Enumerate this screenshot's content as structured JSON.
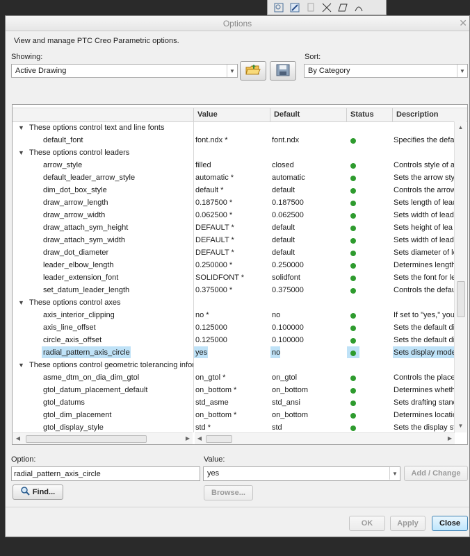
{
  "window": {
    "title": "Options",
    "close_glyph": "✕"
  },
  "description": "View and manage PTC Creo Parametric options.",
  "showing": {
    "label": "Showing:",
    "value": "Active Drawing"
  },
  "sort": {
    "label": "Sort:",
    "value": "By Category"
  },
  "columns": {
    "value": "Value",
    "default": "Default",
    "status": "Status",
    "description": "Description"
  },
  "rows": [
    {
      "type": "group",
      "name": "These options control text and line fonts"
    },
    {
      "type": "option",
      "name": "default_font",
      "value": "font.ndx *",
      "default": "font.ndx",
      "description": "Specifies the defa"
    },
    {
      "type": "group",
      "name": "These options control leaders"
    },
    {
      "type": "option",
      "name": "arrow_style",
      "value": "filled",
      "default": "closed",
      "description": "Controls style of a"
    },
    {
      "type": "option",
      "name": "default_leader_arrow_style",
      "value": "automatic *",
      "default": "automatic",
      "description": "Sets the arrow sty"
    },
    {
      "type": "option",
      "name": "dim_dot_box_style",
      "value": "default *",
      "default": "default",
      "description": "Controls the arrow"
    },
    {
      "type": "option",
      "name": "draw_arrow_length",
      "value": "0.187500 *",
      "default": "0.187500",
      "description": "Sets length of lead"
    },
    {
      "type": "option",
      "name": "draw_arrow_width",
      "value": "0.062500 *",
      "default": "0.062500",
      "description": "Sets width of lead"
    },
    {
      "type": "option",
      "name": "draw_attach_sym_height",
      "value": "DEFAULT *",
      "default": "default",
      "description": "Sets height of lea"
    },
    {
      "type": "option",
      "name": "draw_attach_sym_width",
      "value": "DEFAULT *",
      "default": "default",
      "description": "Sets width of lead"
    },
    {
      "type": "option",
      "name": "draw_dot_diameter",
      "value": "DEFAULT *",
      "default": "default",
      "description": "Sets diameter of le"
    },
    {
      "type": "option",
      "name": "leader_elbow_length",
      "value": "0.250000 *",
      "default": "0.250000",
      "description": "Determines length"
    },
    {
      "type": "option",
      "name": "leader_extension_font",
      "value": "SOLIDFONT *",
      "default": "solidfont",
      "description": "Sets the font for le"
    },
    {
      "type": "option",
      "name": "set_datum_leader_length",
      "value": "0.375000 *",
      "default": "0.375000",
      "description": "Controls the defau"
    },
    {
      "type": "group",
      "name": "These options control axes"
    },
    {
      "type": "option",
      "name": "axis_interior_clipping",
      "value": "no *",
      "default": "no",
      "description": "If set to \"yes,\" you"
    },
    {
      "type": "option",
      "name": "axis_line_offset",
      "value": "0.125000",
      "default": "0.100000",
      "description": "Sets the default di"
    },
    {
      "type": "option",
      "name": "circle_axis_offset",
      "value": "0.125000",
      "default": "0.100000",
      "description": "Sets the default di"
    },
    {
      "type": "option",
      "name": "radial_pattern_axis_circle",
      "value": "yes",
      "default": "no",
      "description": "Sets display mode",
      "selected": true
    },
    {
      "type": "group",
      "name": "These options control geometric tolerancing infor"
    },
    {
      "type": "option",
      "name": "asme_dtm_on_dia_dim_gtol",
      "value": "on_gtol *",
      "default": "on_gtol",
      "description": "Controls the place"
    },
    {
      "type": "option",
      "name": "gtol_datum_placement_default",
      "value": "on_bottom *",
      "default": "on_bottom",
      "description": "Determines wheth"
    },
    {
      "type": "option",
      "name": "gtol_datums",
      "value": "std_asme",
      "default": "std_ansi",
      "description": "Sets drafting stand"
    },
    {
      "type": "option",
      "name": "gtol_dim_placement",
      "value": "on_bottom *",
      "default": "on_bottom",
      "description": "Determines locatio"
    },
    {
      "type": "option",
      "name": "gtol_display_style",
      "value": "std *",
      "default": "std",
      "description": "Sets the display st"
    }
  ],
  "option_field": {
    "label": "Option:",
    "value": "radial_pattern_axis_circle"
  },
  "value_field": {
    "label": "Value:",
    "value": "yes"
  },
  "buttons": {
    "add_change": "Add / Change",
    "find": "Find...",
    "browse": "Browse...",
    "ok": "OK",
    "apply": "Apply",
    "close": "Close"
  },
  "colors": {
    "status_ok": "#2e9b2e",
    "selection": "#bfe2f7",
    "primary_button": "#bee6fd"
  }
}
